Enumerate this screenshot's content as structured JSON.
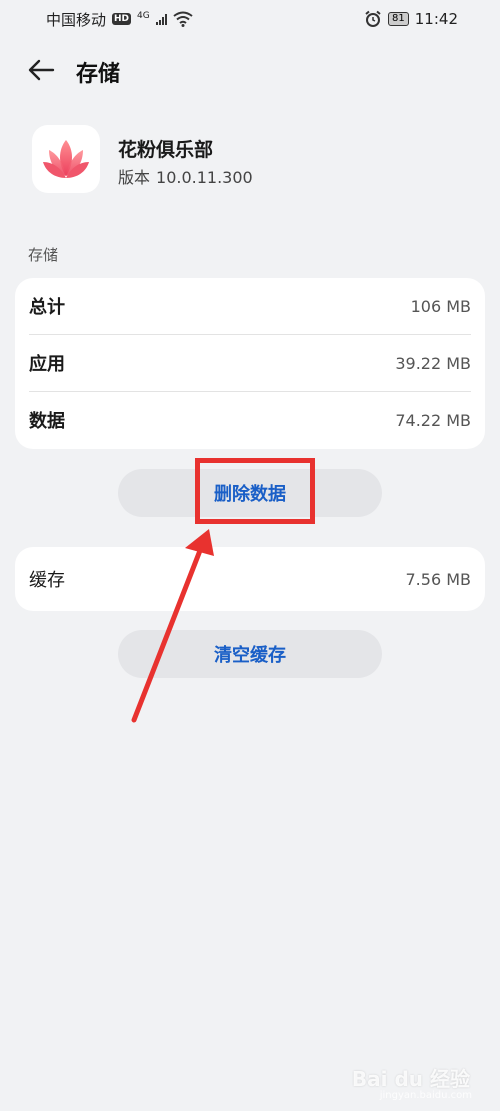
{
  "status_bar": {
    "carrier": "中国移动",
    "hd_badge": "HD",
    "network": "4G",
    "battery": "81",
    "time": "11:42"
  },
  "header": {
    "title": "存储"
  },
  "app": {
    "name": "花粉俱乐部",
    "version_label": "版本",
    "version": "10.0.11.300"
  },
  "storage": {
    "section_label": "存储",
    "rows": [
      {
        "label": "总计",
        "value": "106 MB"
      },
      {
        "label": "应用",
        "value": "39.22 MB"
      },
      {
        "label": "数据",
        "value": "74.22 MB"
      }
    ],
    "delete_button": "删除数据"
  },
  "cache": {
    "label": "缓存",
    "value": "7.56 MB",
    "clear_button": "清空缓存"
  },
  "watermark": {
    "text": "Bai du 经验",
    "sub": "jingyan.baidu.com"
  },
  "colors": {
    "accent": "#1a5fc7",
    "annotation_red": "#e8322f",
    "background": "#f1f2f4"
  }
}
